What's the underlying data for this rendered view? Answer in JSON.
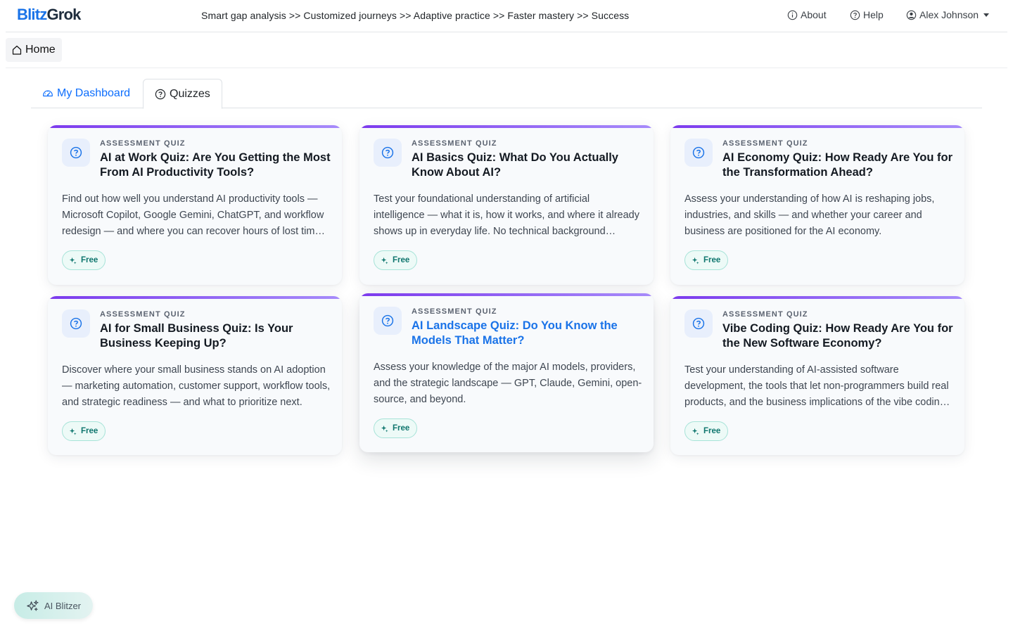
{
  "brand": {
    "part1": "Blitz",
    "part2": "Grok"
  },
  "header": {
    "tagline": "Smart gap analysis >> Customized journeys >> Adaptive practice >> Faster mastery >> Success",
    "about_label": "About",
    "help_label": "Help",
    "user_name": "Alex Johnson"
  },
  "breadcrumb": {
    "home_label": "Home"
  },
  "tabs": [
    {
      "label": "My Dashboard",
      "active": false
    },
    {
      "label": "Quizzes",
      "active": true
    }
  ],
  "quizzes": [
    {
      "kicker": "ASSESSMENT QUIZ",
      "title": "AI at Work Quiz: Are You Getting the Most From AI Productivity Tools?",
      "description": "Find out how well you understand AI productivity tools — Microsoft Copilot, Google Gemini, ChatGPT, and workflow redesign — and where you can recover hours of lost time every week.",
      "badge": "Free"
    },
    {
      "kicker": "ASSESSMENT QUIZ",
      "title": "AI Basics Quiz: What Do You Actually Know About AI?",
      "description": "Test your foundational understanding of artificial intelligence — what it is, how it works, and where it already shows up in everyday life. No technical background required.",
      "badge": "Free"
    },
    {
      "kicker": "ASSESSMENT QUIZ",
      "title": "AI Economy Quiz: How Ready Are You for the Transformation Ahead?",
      "description": "Assess your understanding of how AI is reshaping jobs, industries, and skills — and whether your career and business are positioned for the AI economy.",
      "badge": "Free"
    },
    {
      "kicker": "ASSESSMENT QUIZ",
      "title": "AI for Small Business Quiz: Is Your Business Keeping Up?",
      "description": "Discover where your small business stands on AI adoption — marketing automation, customer support, workflow tools, and strategic readiness — and what to prioritize next.",
      "badge": "Free"
    },
    {
      "kicker": "ASSESSMENT QUIZ",
      "title": "AI Landscape Quiz: Do You Know the Models That Matter?",
      "description": "Assess your knowledge of the major AI models, providers, and the strategic landscape — GPT, Claude, Gemini, open-source, and beyond.",
      "badge": "Free"
    },
    {
      "kicker": "ASSESSMENT QUIZ",
      "title": "Vibe Coding Quiz: How Ready Are You for the New Software Economy?",
      "description": "Test your understanding of AI-assisted software development, the tools that let non-programmers build real products, and the business implications of the vibe coding shift.",
      "badge": "Free"
    }
  ],
  "assistant": {
    "label": "AI Blitzer"
  },
  "colors": {
    "brand_blue": "#1a73e8",
    "accent_purple": "#7c3aed",
    "free_teal": "#0f766e"
  }
}
